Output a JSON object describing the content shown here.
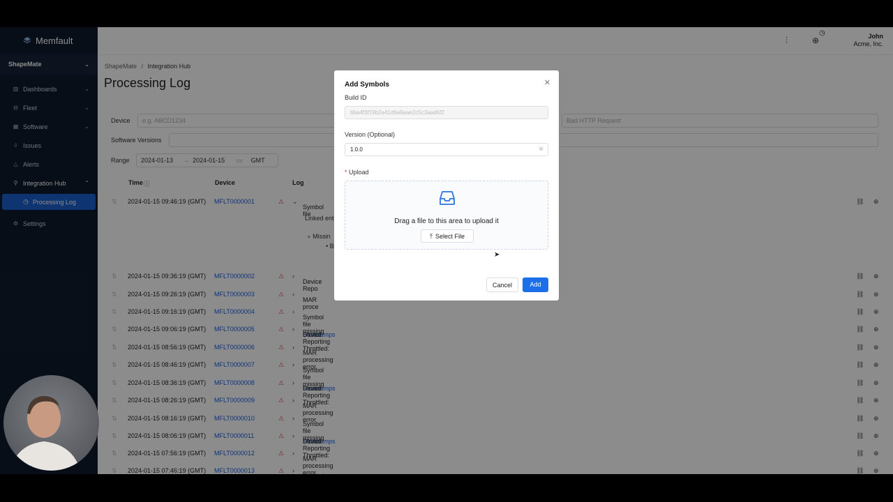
{
  "app": {
    "name": "Memfault",
    "project": "ShapeMate"
  },
  "sidebar": {
    "items": [
      {
        "label": "Dashboards",
        "icon": "chart-icon",
        "chevron": "⌄"
      },
      {
        "label": "Fleet",
        "icon": "fleet-icon",
        "chevron": "⌄"
      },
      {
        "label": "Software",
        "icon": "grid-icon",
        "chevron": "⌄"
      },
      {
        "label": "Issues",
        "icon": "bug-icon"
      },
      {
        "label": "Alerts",
        "icon": "bell-icon"
      },
      {
        "label": "Integration Hub",
        "icon": "link-icon",
        "chevron": "⌃"
      },
      {
        "label": "Processing Log",
        "icon": "clock-icon",
        "active": true
      },
      {
        "label": "Settings",
        "icon": "gear-icon"
      }
    ]
  },
  "header": {
    "user_name": "John",
    "user_org": "Acme, Inc."
  },
  "breadcrumb": {
    "parent": "ShapeMate",
    "separator": "/",
    "current": "Integration Hub"
  },
  "page": {
    "title": "Processing Log"
  },
  "filters": {
    "device_label": "Device",
    "device_placeholder": "e.g. ABCD1234",
    "type_placeholder": "Bad HTTP Request",
    "software_label": "Software Versions",
    "range_label": "Range",
    "range_start": "2024-01-13",
    "range_arrow": "→",
    "range_end": "2024-01-15",
    "timezone": "GMT"
  },
  "table": {
    "headers": {
      "time": "Time",
      "device": "Device",
      "log": "Log"
    },
    "expanded": {
      "linked": "Linked ent",
      "missing": "Missin",
      "build": "Bui"
    },
    "rows": [
      {
        "time": "2024-01-15 09:46:19 (GMT)",
        "device": "MFLT0000001",
        "msg": "Symbol file",
        "link": "",
        "suffix": ""
      },
      {
        "time": "2024-01-15 09:36:19 (GMT)",
        "device": "MFLT0000002",
        "msg": "Device Repo",
        "link": "",
        "suffix": ""
      },
      {
        "time": "2024-01-15 09:26:19 (GMT)",
        "device": "MFLT0000003",
        "msg": "MAR proce",
        "link": "",
        "suffix": ""
      },
      {
        "time": "2024-01-15 09:16:19 (GMT)",
        "device": "MFLT0000004",
        "msg": "Symbol file missing",
        "link": "",
        "suffix": ""
      },
      {
        "time": "2024-01-15 09:06:19 (GMT)",
        "device": "MFLT0000005",
        "msg": "Device Reporting Throttled: ",
        "link": "Coredumps",
        "suffix": " Stored"
      },
      {
        "time": "2024-01-15 08:56:19 (GMT)",
        "device": "MFLT0000006",
        "msg": "MAR processing error",
        "link": "",
        "suffix": ""
      },
      {
        "time": "2024-01-15 08:46:19 (GMT)",
        "device": "MFLT0000007",
        "msg": "Symbol file missing",
        "link": "",
        "suffix": ""
      },
      {
        "time": "2024-01-15 08:36:19 (GMT)",
        "device": "MFLT0000008",
        "msg": "Device Reporting Throttled: ",
        "link": "Coredumps",
        "suffix": " Stored"
      },
      {
        "time": "2024-01-15 08:26:19 (GMT)",
        "device": "MFLT0000009",
        "msg": "MAR processing error",
        "link": "",
        "suffix": ""
      },
      {
        "time": "2024-01-15 08:16:19 (GMT)",
        "device": "MFLT0000010",
        "msg": "Symbol file missing",
        "link": "",
        "suffix": ""
      },
      {
        "time": "2024-01-15 08:06:19 (GMT)",
        "device": "MFLT0000011",
        "msg": "Device Reporting Throttled: ",
        "link": "Coredumps",
        "suffix": " Stored"
      },
      {
        "time": "2024-01-15 07:56:19 (GMT)",
        "device": "MFLT0000012",
        "msg": "MAR processing error",
        "link": "",
        "suffix": ""
      },
      {
        "time": "2024-01-15 07:46:19 (GMT)",
        "device": "MFLT0000013",
        "msg": "Symbol file missing",
        "link": "",
        "suffix": ""
      }
    ]
  },
  "modal": {
    "title": "Add Symbols",
    "build_id_label": "Build ID",
    "build_id_value": "6ba4f3f19b2e41d6a9aae2c5c3aad6f2",
    "version_label": "Version (Optional)",
    "version_value": "1.0.0",
    "upload_required": "*",
    "upload_label": "Upload",
    "drop_text": "Drag a file to this area to upload it",
    "select_file": "Select File",
    "cancel": "Cancel",
    "add": "Add"
  },
  "colors": {
    "sidebar_bg": "#0f1b2d",
    "active_item": "#1d5fd0",
    "link": "#1a5fd6",
    "primary_button": "#1c6fe8",
    "warning": "#d33333"
  }
}
